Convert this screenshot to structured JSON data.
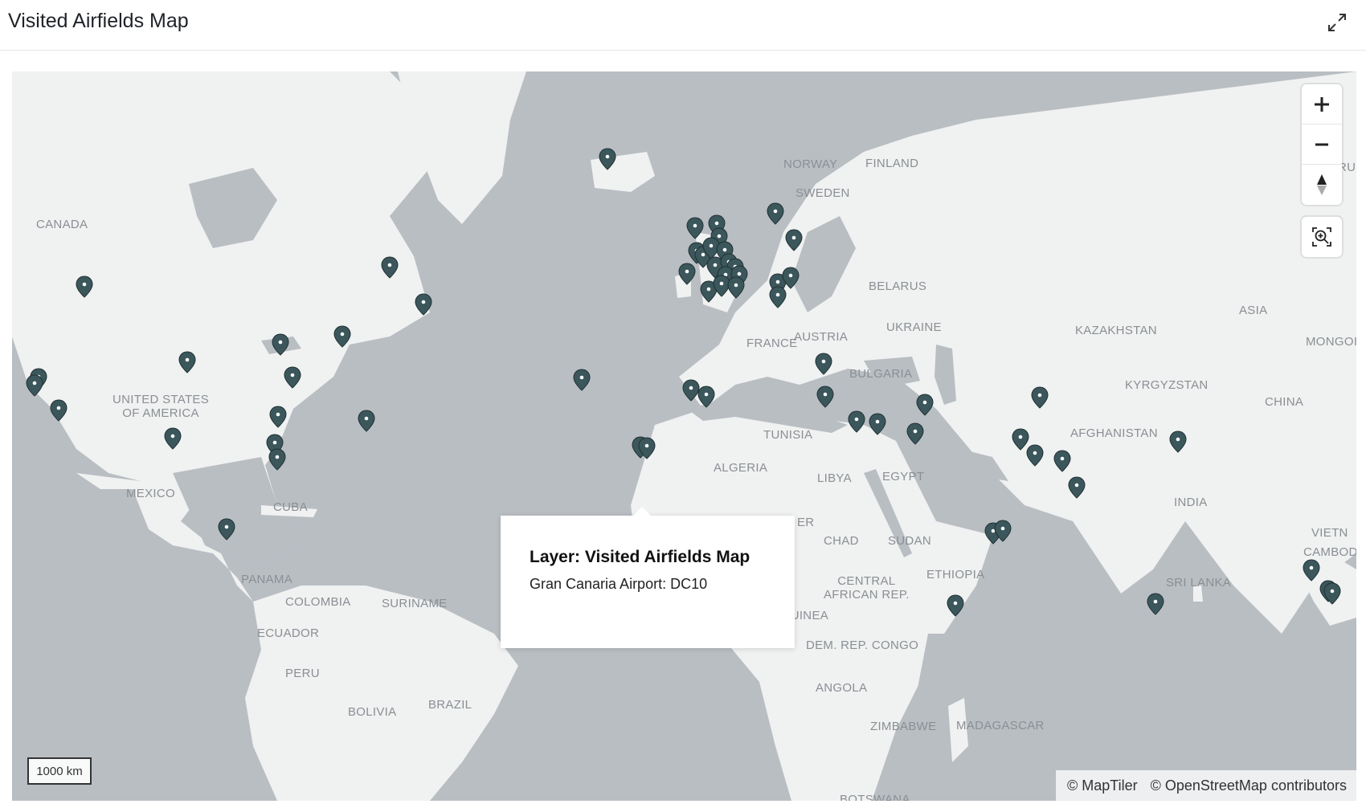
{
  "header": {
    "title": "Visited Airfields Map",
    "expand_icon": "expand-icon"
  },
  "map": {
    "labels": {
      "canada": "CANADA",
      "usa": "UNITED STATES\nOF AMERICA",
      "mexico": "MEXICO",
      "cuba": "CUBA",
      "panama": "PANAMA",
      "colombia": "COLOMBIA",
      "suriname": "SURINAME",
      "ecuador": "ECUADOR",
      "peru": "PERU",
      "bolivia": "BOLIVIA",
      "brazil": "BRAZIL",
      "norway": "NORWAY",
      "finland": "FINLAND",
      "sweden": "SWEDEN",
      "belarus": "BELARUS",
      "ukraine": "UKRAINE",
      "france": "FRANCE",
      "austria": "AUSTRIA",
      "bulgaria": "BULGARIA",
      "tunisia": "TUNISIA",
      "algeria": "ALGERIA",
      "libya": "LIBYA",
      "egypt": "EGYPT",
      "chad": "CHAD",
      "sudan": "SUDAN",
      "ethiopia": "ETHIOPIA",
      "car": "CENTRAL\nAFRICAN REP.",
      "eqguinea": "EQ.GUINEA",
      "drc": "DEM. REP. CONGO",
      "angola": "ANGOLA",
      "zimbabwe": "ZIMBABWE",
      "madagascar": "MADAGASCAR",
      "botswana": "BOTSWANA",
      "niger_partial": "ER",
      "kazakhstan": "KAZAKHSTAN",
      "kyrgyzstan": "KYRGYZSTAN",
      "afghanistan": "AFGHANISTAN",
      "china": "CHINA",
      "mongolia": "MONGOI",
      "asia": "ASIA",
      "india": "INDIA",
      "srilanka": "SRI LANKA",
      "vietnam": "VIETN",
      "cambodia": "CAMBOD",
      "russia_partial": "RU"
    },
    "controls": {
      "zoom_in_icon": "plus-icon",
      "zoom_out_icon": "minus-icon",
      "compass_icon": "compass-icon",
      "fit_icon": "zoom-to-fit-icon"
    },
    "scale_label": "1000 km",
    "attribution": {
      "maptiler": "© MapTiler",
      "osm": "© OpenStreetMap contributors"
    },
    "colors": {
      "water": "#b9bec3",
      "land": "#f0f1f1",
      "pin": "#3c575b"
    }
  },
  "popup": {
    "title": "Layer: Visited Airfields Map",
    "body": "Gran Canaria Airport: DC10"
  }
}
